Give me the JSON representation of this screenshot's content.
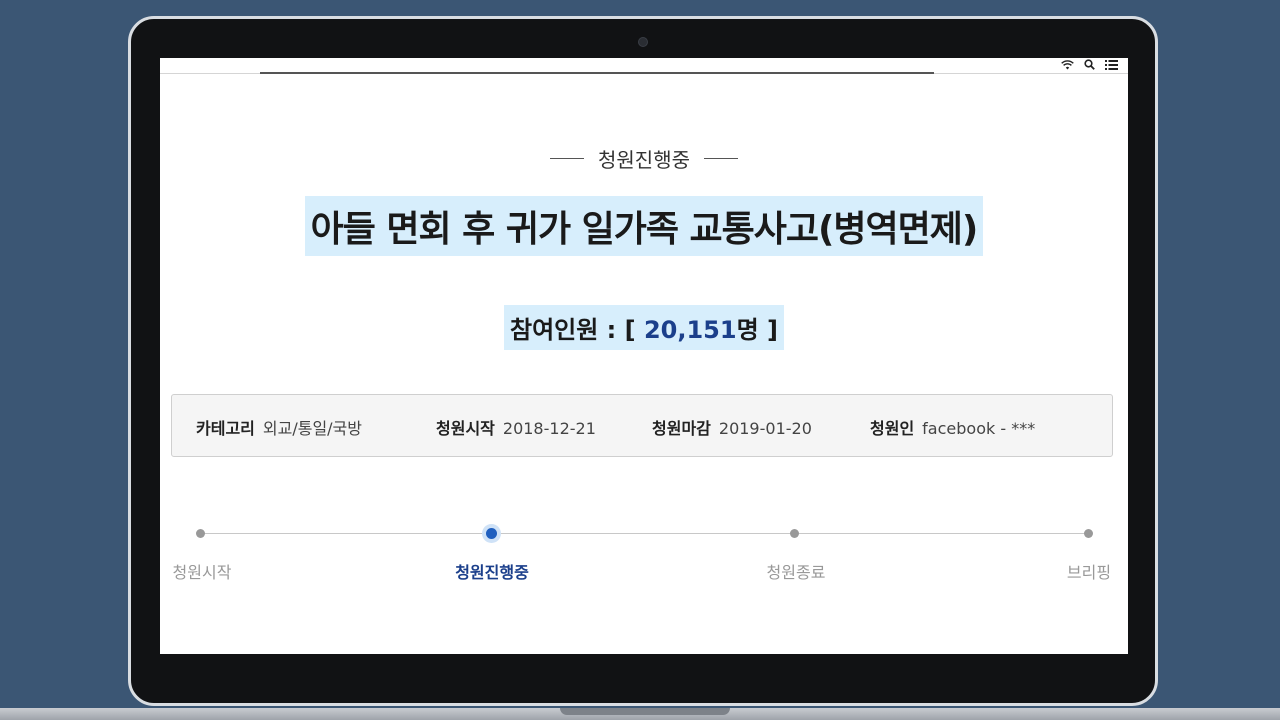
{
  "petition": {
    "status_label": "청원진행중",
    "title": "아들 면회 후 귀가 일가족 교통사고(병역면제)",
    "participants": {
      "label": "참여인원 : [ ",
      "count": "20,151",
      "unit": "명 ]"
    },
    "info": {
      "category_key": "카테고리",
      "category_value": "외교/통일/국방",
      "start_key": "청원시작",
      "start_value": "2018-12-21",
      "end_key": "청원마감",
      "end_value": "2019-01-20",
      "author_key": "청원인",
      "author_value": "facebook - ***"
    },
    "steps": [
      {
        "label": "청원시작",
        "active": false
      },
      {
        "label": "청원진행중",
        "active": true
      },
      {
        "label": "청원종료",
        "active": false
      },
      {
        "label": "브리핑",
        "active": false
      }
    ]
  },
  "status_bar": {
    "icons": [
      "wifi-icon",
      "search-icon",
      "menu-icon"
    ]
  },
  "colors": {
    "background": "#3b5674",
    "highlight": "#d7eefc",
    "accent": "#1b3f8b"
  }
}
